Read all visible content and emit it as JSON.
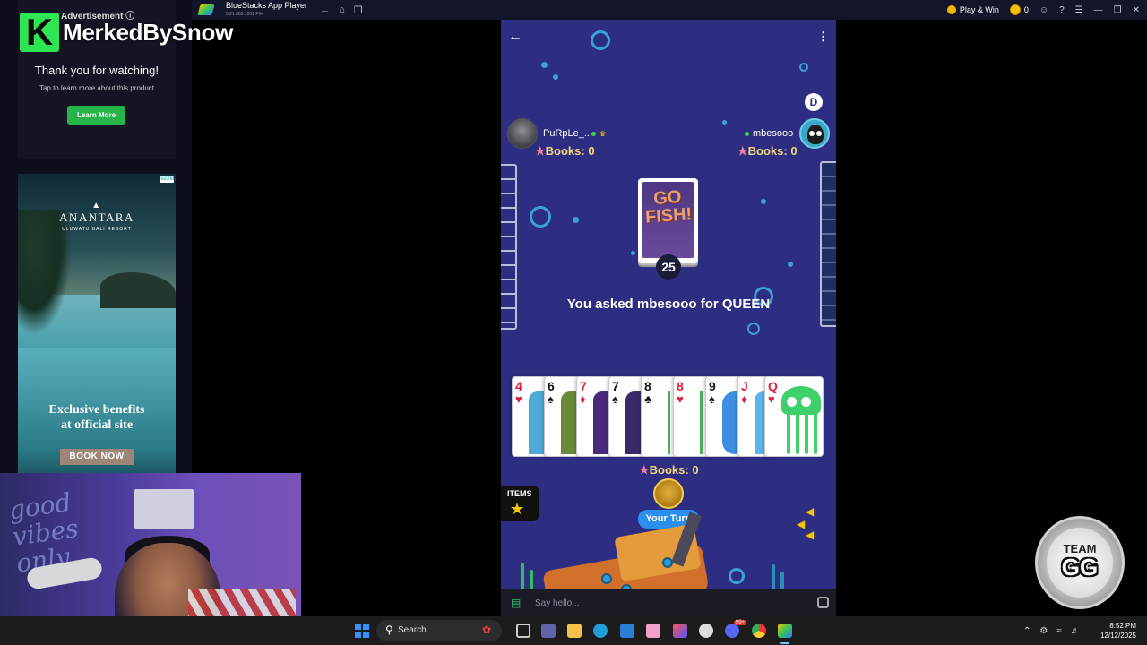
{
  "stream": {
    "channel_name": "MerkedBySnow",
    "logo_letter": "K"
  },
  "bluestacks": {
    "title": "BlueStacks App Player",
    "version": "5.21.660.1002  P64",
    "play_win": "Play & Win",
    "coin_count": "0"
  },
  "ads": {
    "label": "Advertisement ⓘ",
    "thanks": "Thank you for watching!",
    "tap_text": "Tap to learn more about this product",
    "learn_more": "Learn More",
    "hotel_name": "ANANTARA",
    "hotel_sub": "ULUWATU BALI RESORT",
    "benefits_line1": "Exclusive benefits",
    "benefits_line2": "at official site",
    "book_now": "BOOK NOW"
  },
  "game": {
    "dealer_badge": "D",
    "opponent_left": {
      "name": "PuRpLe_...",
      "books": "Books: 0"
    },
    "opponent_right": {
      "name": "mbesooo",
      "books": "Books: 0"
    },
    "deck_title": "GO FISH!",
    "deck_count": "25",
    "message": "You asked mbesooo for QUEEN",
    "hand": [
      {
        "rank": "4",
        "suit": "♥",
        "color": "red"
      },
      {
        "rank": "6",
        "suit": "♠",
        "color": "black"
      },
      {
        "rank": "7",
        "suit": "♦",
        "color": "red"
      },
      {
        "rank": "7",
        "suit": "♠",
        "color": "black"
      },
      {
        "rank": "8",
        "suit": "♣",
        "color": "black"
      },
      {
        "rank": "8",
        "suit": "♥",
        "color": "red"
      },
      {
        "rank": "9",
        "suit": "♠",
        "color": "black"
      },
      {
        "rank": "J",
        "suit": "♦",
        "color": "red"
      },
      {
        "rank": "Q",
        "suit": "♥",
        "color": "red"
      }
    ],
    "my_books": "Books: 0",
    "your_turn": "Your Turn",
    "items_label": "ITEMS",
    "chat_placeholder": "Say hello..."
  },
  "overlay": {
    "team_top": "TEAM",
    "team_gg": "GG"
  },
  "taskbar": {
    "search_label": "Search",
    "time": "8:52 PM",
    "date": "12/12/2025",
    "notification_badge": "99+"
  },
  "colors": {
    "game_bg": "#2d2d82",
    "accent_blue": "#2b8ff0",
    "books_yellow": "#f5d77a",
    "brand_green": "#2ee553"
  }
}
